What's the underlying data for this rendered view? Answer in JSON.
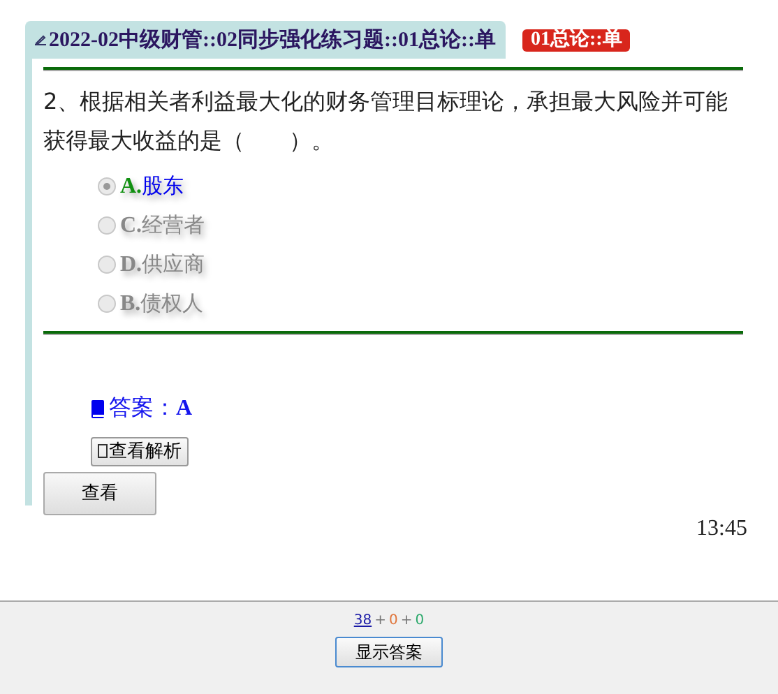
{
  "header": {
    "title": "2022-02中级财管::02同步强化练习题::01总论::单",
    "tag": "01总论::单"
  },
  "question": {
    "text": "2、根据相关者利益最大化的财务管理目标理论，承担最大风险并可能获得最大收益的是（　　）。",
    "options": [
      {
        "letter": "A.",
        "label": "股东",
        "selected": true
      },
      {
        "letter": "C.",
        "label": "经营者",
        "selected": false
      },
      {
        "letter": "D.",
        "label": "供应商",
        "selected": false
      },
      {
        "letter": "B.",
        "label": "债权人",
        "selected": false
      }
    ]
  },
  "answer": {
    "label": "答案：",
    "value": "A"
  },
  "analysis_button": "查看解析",
  "view_button": "查看",
  "time": "13:45",
  "footer": {
    "counts": [
      {
        "kind": "link",
        "text": "38",
        "color": "#1a1aa6"
      },
      {
        "kind": "plus",
        "text": "+"
      },
      {
        "kind": "count",
        "text": "0",
        "color": "#e0743a"
      },
      {
        "kind": "plus",
        "text": "+"
      },
      {
        "kind": "count",
        "text": "0",
        "color": "#2aa86a"
      }
    ],
    "button": "显示答案"
  }
}
